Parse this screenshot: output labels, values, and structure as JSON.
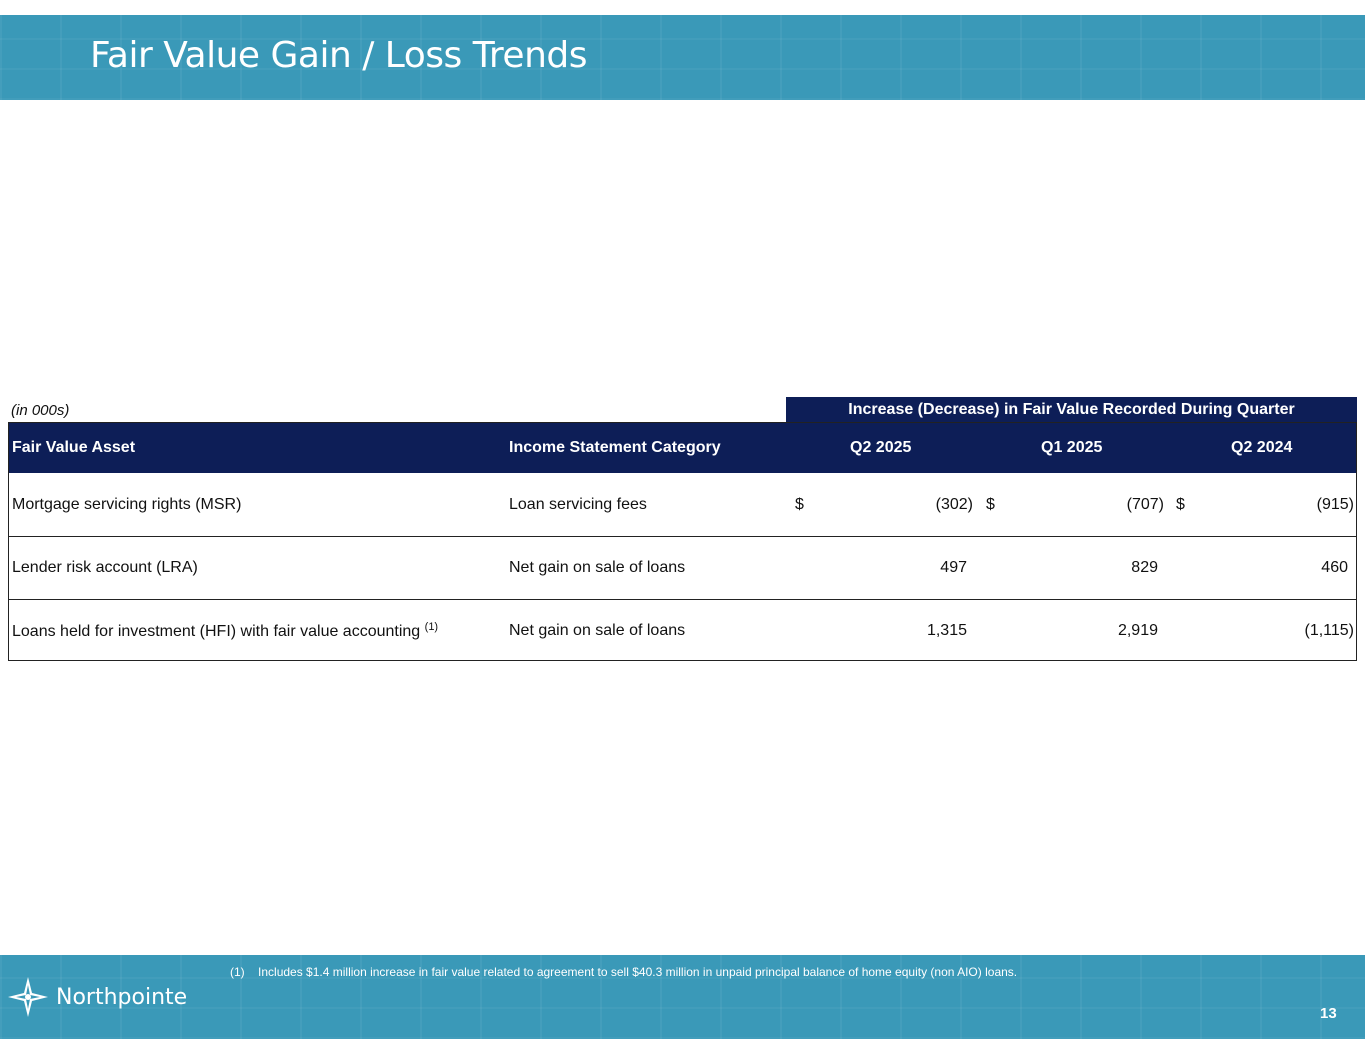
{
  "header": {
    "title": "Fair Value Gain / Loss Trends"
  },
  "table": {
    "units": "(in 000s)",
    "group_header": "Increase (Decrease) in Fair Value Recorded During Quarter",
    "columns": [
      "Fair Value Asset",
      "Income Statement Category",
      "Q2 2025",
      "Q1 2025",
      "Q2 2024"
    ],
    "rows": [
      {
        "asset": "Mortgage servicing rights (MSR)",
        "asset_sup": "",
        "category": "Loan servicing fees",
        "currency": "$",
        "q2_2025": "(302)",
        "q1_2025": "(707)",
        "q2_2024": "(915)"
      },
      {
        "asset": "Lender risk account (LRA)",
        "asset_sup": "",
        "category": "Net gain on sale of loans",
        "currency": "",
        "q2_2025": "497",
        "q1_2025": "829",
        "q2_2024": "460"
      },
      {
        "asset": "Loans held for investment (HFI) with fair value accounting",
        "asset_sup": "(1)",
        "category": "Net gain on sale of loans",
        "currency": "",
        "q2_2025": "1,315",
        "q1_2025": "2,919",
        "q2_2024": "(1,115)"
      }
    ]
  },
  "footer": {
    "footnote_marker": "(1)",
    "footnote": "Includes $1.4 million increase in fair value related to agreement to sell $40.3 million in unpaid principal balance of home equity (non AIO) loans.",
    "logo_text": "Northpointe",
    "logo_icon": "compass-star-icon",
    "page_number": "13"
  }
}
